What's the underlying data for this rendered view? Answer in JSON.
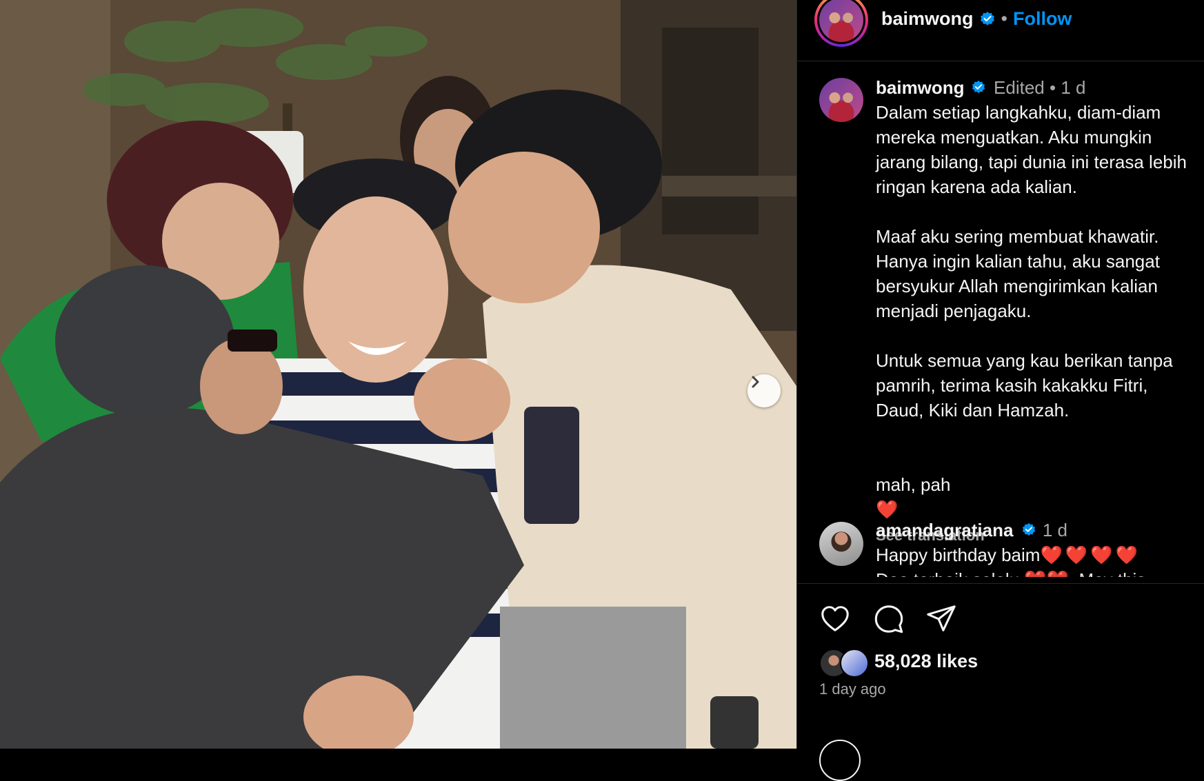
{
  "post": {
    "username": "baimwong",
    "follow_label": "Follow",
    "separator": "•"
  },
  "caption": {
    "username": "baimwong",
    "edited": "Edited",
    "time": "1 d",
    "paragraphs": [
      "Dalam setiap langkahku, diam-diam mereka menguatkan. Aku mungkin jarang bilang, tapi dunia ini terasa lebih ringan karena ada kalian.",
      "Maaf aku sering membuat khawatir. Hanya ingin kalian tahu, aku sangat bersyukur Allah mengirimkan kalian menjadi penjagaku.",
      "Untuk semua yang kau berikan tanpa pamrih, terima kasih kakakku Fitri, Daud, Kiki dan Hamzah."
    ],
    "closing": "mah, pah",
    "closing_emoji": "❤️",
    "see_translation": "See translation"
  },
  "comments": [
    {
      "username": "amandagratiana",
      "time": "1 d",
      "text": "Happy birthday baim",
      "emoji": "❤️❤️❤️❤️",
      "next_line": "Doa terbaik selalu ❤️❤️. May this"
    }
  ],
  "actions": {
    "like_icon": "heart-outline-icon",
    "comment_icon": "comment-bubble-icon",
    "share_icon": "paper-plane-icon",
    "likes_text": "58,028 likes",
    "time_ago": "1 day ago"
  },
  "photo": {
    "next_icon": "chevron-right-icon"
  },
  "colors": {
    "background": "#000000",
    "accent_blue": "#0095f6",
    "muted": "#a8a8a8",
    "divider": "#262626"
  }
}
